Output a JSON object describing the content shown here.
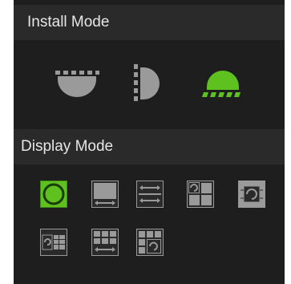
{
  "install_section": {
    "title": "Install Mode",
    "modes": [
      {
        "name": "ceiling",
        "icon": "ceiling-mount-icon",
        "selected": false
      },
      {
        "name": "wall",
        "icon": "wall-mount-icon",
        "selected": false
      },
      {
        "name": "floor",
        "icon": "floor-mount-icon",
        "selected": true
      }
    ]
  },
  "display_section": {
    "title": "Display Mode",
    "modes": [
      {
        "icon": "fisheye-original-icon",
        "selected": true
      },
      {
        "icon": "panorama-icon",
        "selected": false
      },
      {
        "icon": "double-panorama-icon",
        "selected": false
      },
      {
        "icon": "fisheye-plus-3ptz-icon",
        "selected": false
      },
      {
        "icon": "fisheye-plus-8ptz-icon",
        "selected": false
      },
      {
        "icon": "fisheye-plus-6ptz-icon",
        "selected": false
      },
      {
        "icon": "panorama-plus-6ptz-icon",
        "selected": false
      },
      {
        "icon": "fisheye-plus-panorama-plus-ptz-icon",
        "selected": false
      }
    ]
  },
  "colors": {
    "panel_bg": "#1e1e1e",
    "header_bg": "#2a2a2a",
    "icon_gray": "#9a9a9a",
    "accent_green": "#5ec11f"
  }
}
